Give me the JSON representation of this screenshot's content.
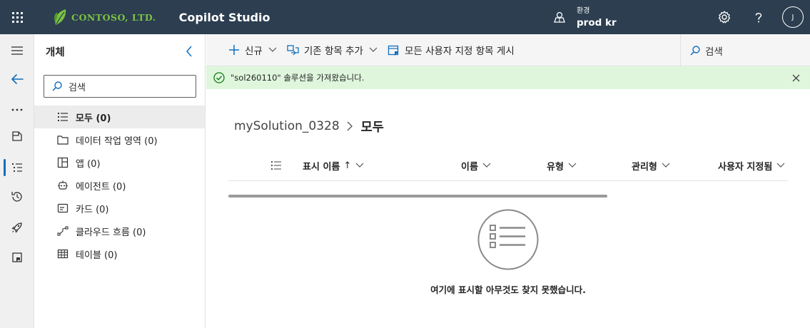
{
  "header": {
    "brand": "CONTOSO, LTD.",
    "app_title": "Copilot Studio",
    "env_label": "환경",
    "env_name": "prod kr",
    "avatar_initial": "J"
  },
  "objects": {
    "title": "개체",
    "search_placeholder": "검색",
    "items": [
      {
        "label": "모두",
        "count": "(0)",
        "icon": "list-icon",
        "selected": true
      },
      {
        "label": "데이터 작업 영역",
        "count": "(0)",
        "icon": "folder-icon"
      },
      {
        "label": "앱",
        "count": "(0)",
        "icon": "app-icon"
      },
      {
        "label": "에이전트",
        "count": "(0)",
        "icon": "agent-icon"
      },
      {
        "label": "카드",
        "count": "(0)",
        "icon": "card-icon"
      },
      {
        "label": "클라우드 흐름",
        "count": "(0)",
        "icon": "flow-icon"
      },
      {
        "label": "테이블",
        "count": "(0)",
        "icon": "table-icon"
      }
    ]
  },
  "commands": {
    "new": "신규",
    "add_existing": "기존 항목 추가",
    "publish_all": "모든 사용자 지정 항목 게시",
    "search_placeholder": "검색"
  },
  "notification": {
    "message": "\"sol260110\" 솔루션을 가져왔습니다."
  },
  "breadcrumb": {
    "solution": "mySolution_0328",
    "current": "모두"
  },
  "table": {
    "columns": {
      "display_name": "표시 이름",
      "sort_arrow": "↑",
      "name": "이름",
      "type": "유형",
      "managed": "관리형",
      "customized": "사용자 지정됨"
    }
  },
  "empty": {
    "message": "여기에 표시할 아무것도 찾지 못했습니다."
  },
  "colors": {
    "topbar": "#2c3e50",
    "brand_green": "#7cc242",
    "notice_bg": "#dff6dd",
    "success_green": "#107c10",
    "accent_blue": "#106ebe"
  }
}
